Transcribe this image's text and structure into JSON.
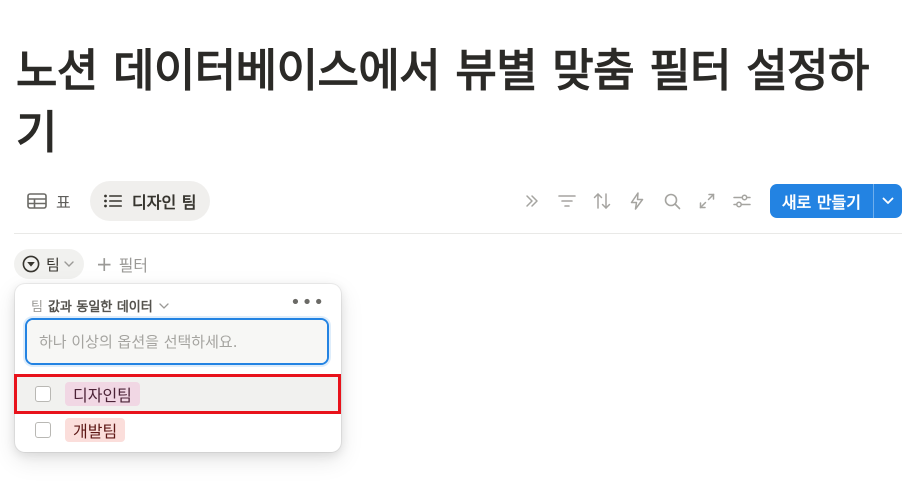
{
  "page": {
    "title": "노션 데이터베이스에서 뷰별 맞춤 필터 설정하기"
  },
  "views": {
    "tabs": [
      {
        "label": "표",
        "icon": "table-icon",
        "active": false
      },
      {
        "label": "디자인 팀",
        "icon": "list-icon",
        "active": true
      }
    ]
  },
  "toolbar": {
    "icons": [
      "double-chevron-icon",
      "filter-icon",
      "sort-icon",
      "lightning-icon",
      "search-icon",
      "expand-icon",
      "settings-sliders-icon"
    ],
    "new_button_label": "새로 만들기",
    "accent_color": "#2383e2"
  },
  "filters": {
    "chip_label": "팀",
    "add_filter_label": "필터"
  },
  "filter_popover": {
    "property": "팀",
    "condition": "값과 동일한 데이터",
    "more_label": "•••",
    "search_placeholder": "하나 이상의 옵션을 선택하세요.",
    "search_value": "",
    "options": [
      {
        "label": "디자인팀",
        "checked": false,
        "color": "#f1d7e4",
        "highlighted": true
      },
      {
        "label": "개발팀",
        "checked": false,
        "color": "#fbdedb",
        "highlighted": false
      }
    ]
  },
  "annotation": {
    "highlight_color": "#e8121b"
  }
}
